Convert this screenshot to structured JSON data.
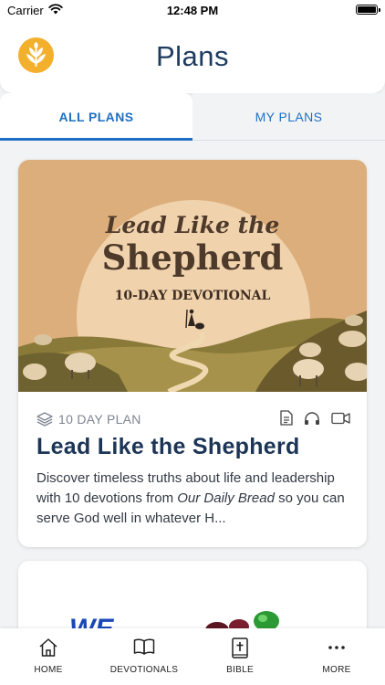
{
  "status_bar": {
    "carrier": "Carrier",
    "time": "12:48 PM"
  },
  "header": {
    "title": "Plans",
    "logo_icon": "wheat-logo-icon"
  },
  "tabs": [
    {
      "label": "ALL PLANS",
      "active": true
    },
    {
      "label": "MY PLANS",
      "active": false
    }
  ],
  "plans": [
    {
      "image_text": {
        "line1": "Lead Like the",
        "line2": "Shepherd",
        "subtitle": "10-DAY DEVOTIONAL"
      },
      "meta": "10 DAY PLAN",
      "media_icons": [
        "document-icon",
        "headphones-icon",
        "video-icon"
      ],
      "title": "Lead Like the Shepherd",
      "desc_before": "Discover timeless truths about life and leadership with 10 devotions from ",
      "desc_italic": "Our Daily Bread",
      "desc_after": " so you can serve God well in whatever H..."
    },
    {
      "image_text": "WE"
    }
  ],
  "bottom_nav": [
    {
      "label": "HOME",
      "icon": "home-icon"
    },
    {
      "label": "DEVOTIONALS",
      "icon": "open-book-icon"
    },
    {
      "label": "BIBLE",
      "icon": "bible-icon"
    },
    {
      "label": "MORE",
      "icon": "more-dots-icon"
    }
  ],
  "colors": {
    "accent": "#1f6fc4",
    "title": "#1c3556",
    "logo": "#f3b02c"
  }
}
